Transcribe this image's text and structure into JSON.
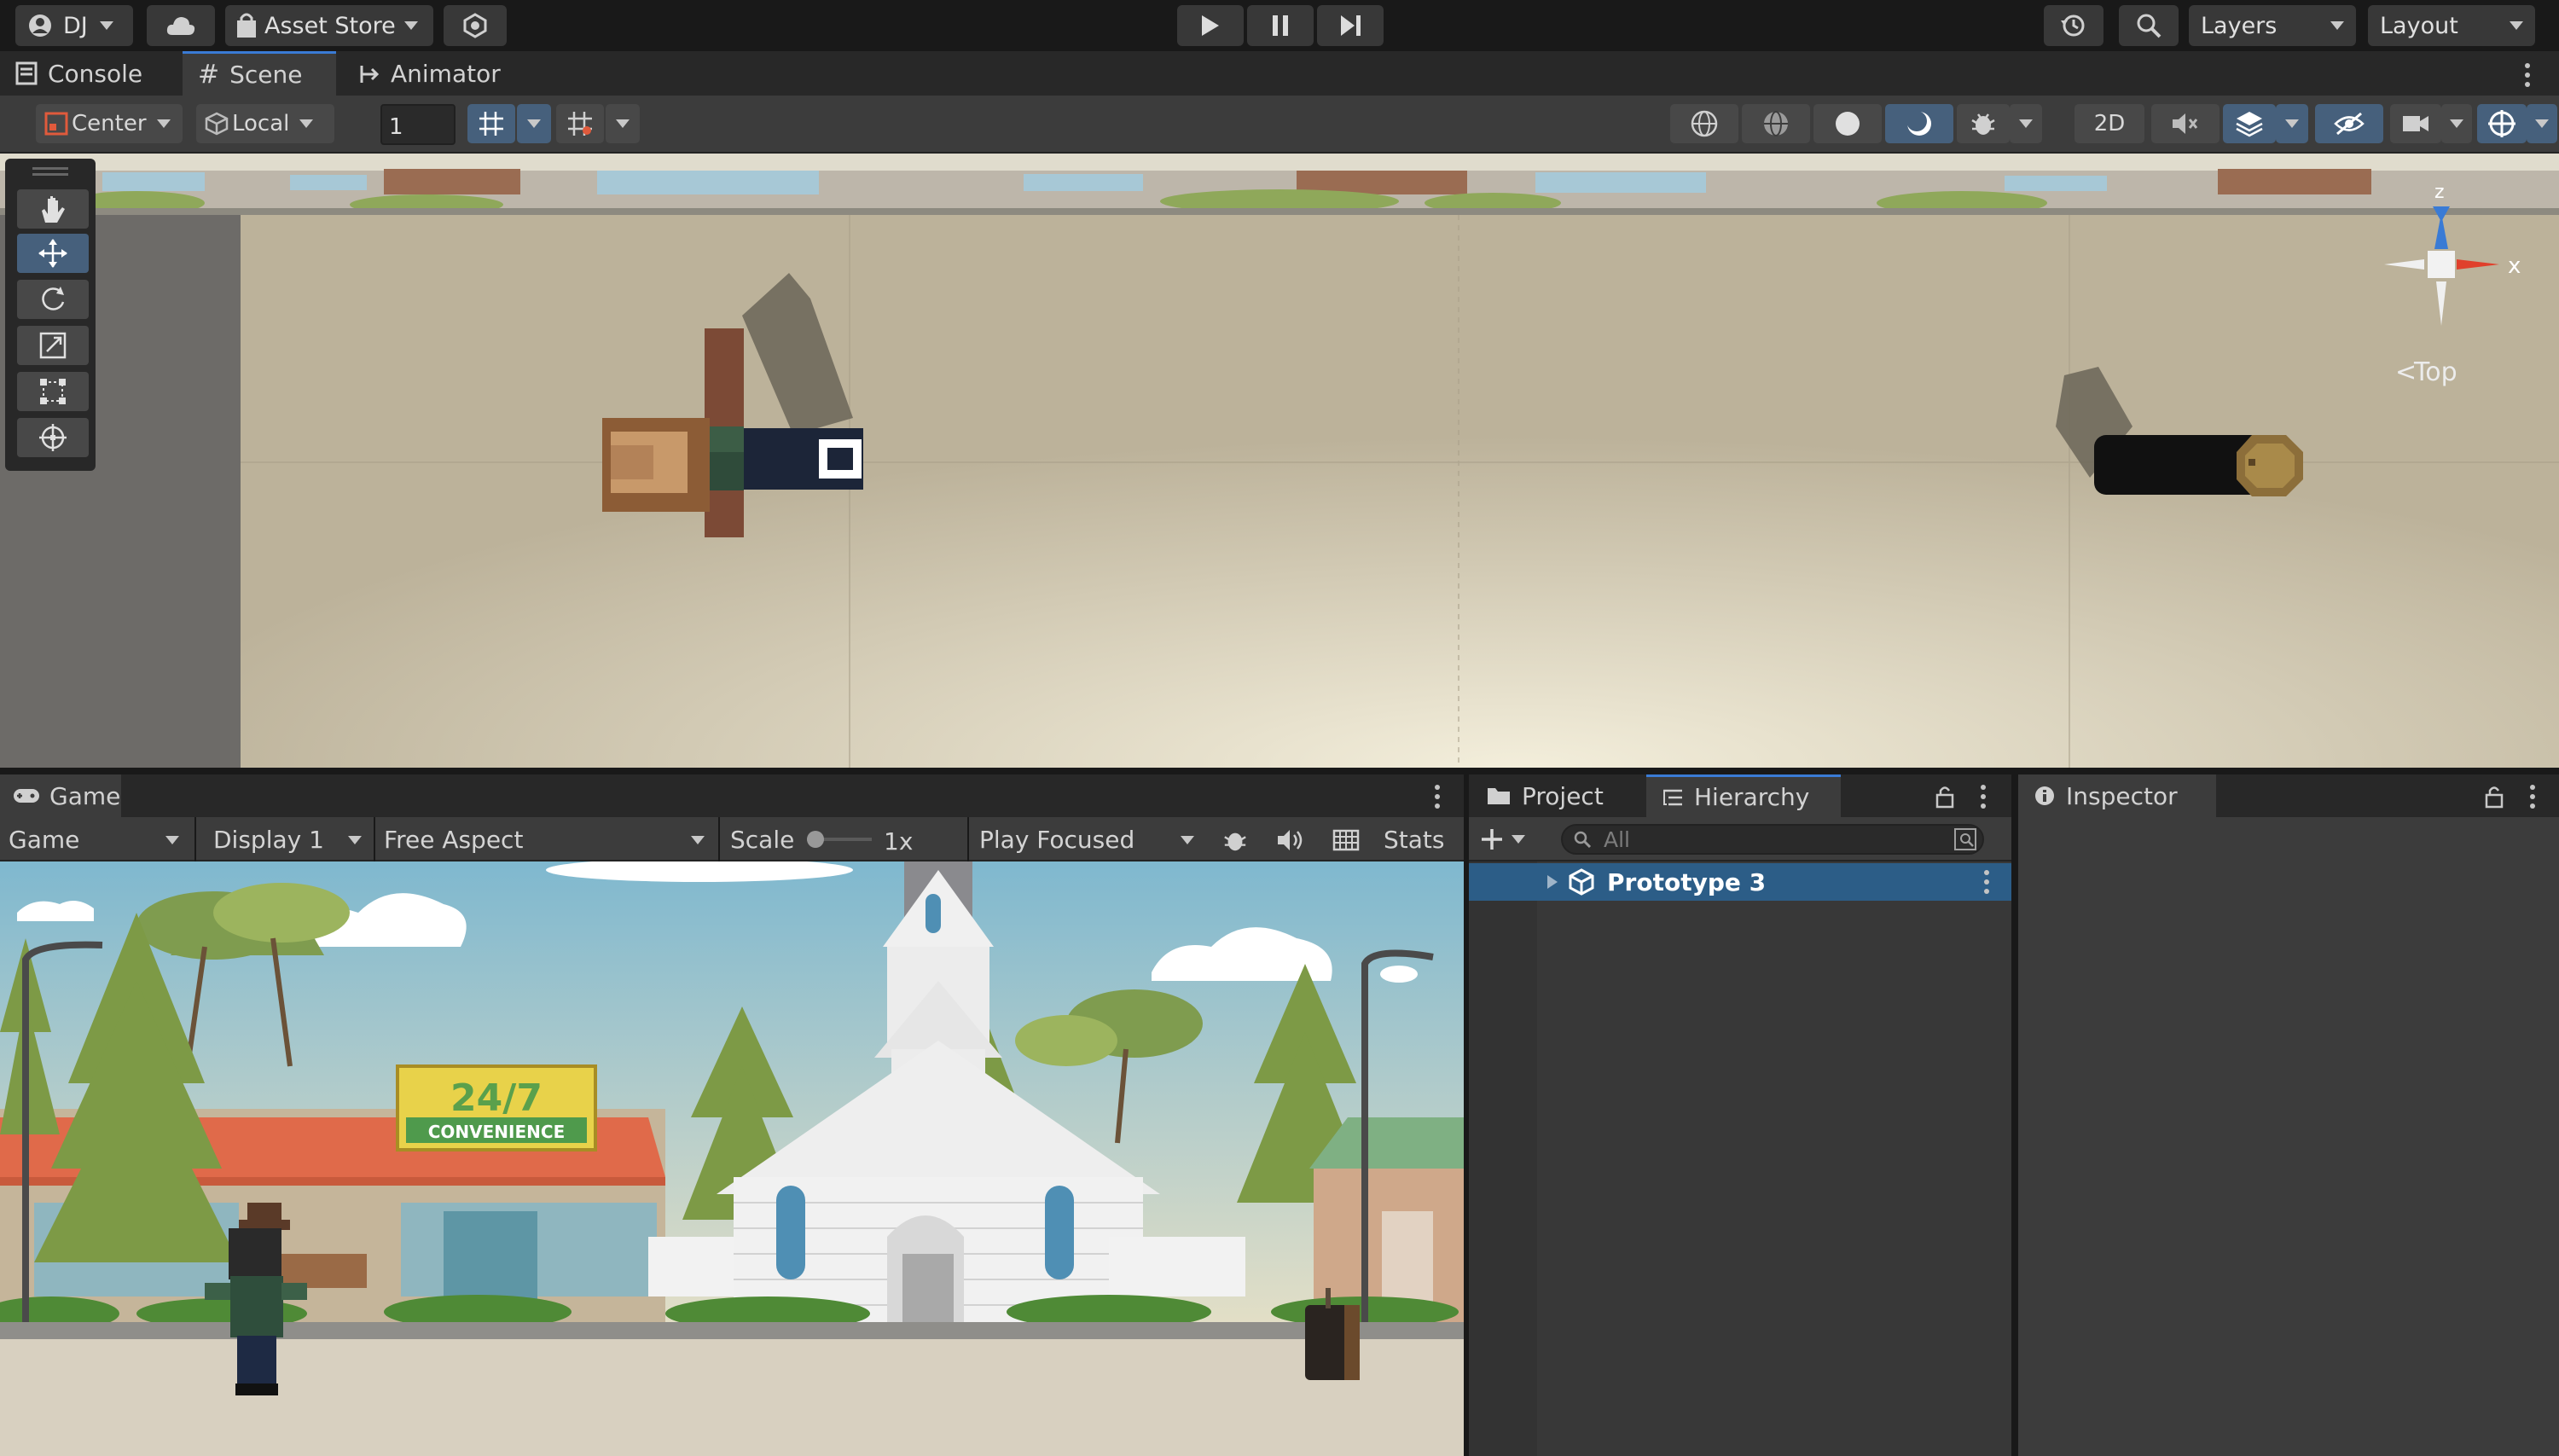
{
  "toolbar": {
    "account_label": "DJ",
    "asset_store_label": "Asset Store",
    "layers_label": "Layers",
    "layout_label": "Layout"
  },
  "scene_tabs": [
    {
      "label": "Console",
      "icon": "console-icon"
    },
    {
      "label": "Scene",
      "icon": "grid-icon"
    },
    {
      "label": "Animator",
      "icon": "animator-icon"
    }
  ],
  "scene_toolbar": {
    "pivot_label": "Center",
    "space_label": "Local",
    "grid_snap_value": "1",
    "mode_2d_label": "2D"
  },
  "scene_view": {
    "orientation_label": "Top",
    "axis_x": "x",
    "axis_z": "z"
  },
  "game_tabs": [
    {
      "label": "Game",
      "icon": "gamepad-icon"
    }
  ],
  "game_toolbar": {
    "view_label": "Game",
    "display_label": "Display 1",
    "aspect_label": "Free Aspect",
    "scale_label": "Scale",
    "scale_value": "1x",
    "play_mode_label": "Play Focused",
    "stats_label": "Stats"
  },
  "game_view": {
    "sign_line1": "24/7",
    "sign_line2": "CONVENIENCE"
  },
  "hierarchy_tabs": [
    {
      "label": "Project",
      "icon": "folder-icon"
    },
    {
      "label": "Hierarchy",
      "icon": "hierarchy-icon"
    }
  ],
  "hierarchy": {
    "search_placeholder": "All",
    "items": [
      {
        "label": "Prototype 3",
        "icon": "unity-scene-icon",
        "selected": true
      }
    ]
  },
  "inspector_tabs": [
    {
      "label": "Inspector",
      "icon": "info-icon"
    }
  ],
  "colors": {
    "accent": "#3a7bd5",
    "selection": "#2c5d87",
    "panel": "#383838",
    "toolbar": "#191919"
  }
}
